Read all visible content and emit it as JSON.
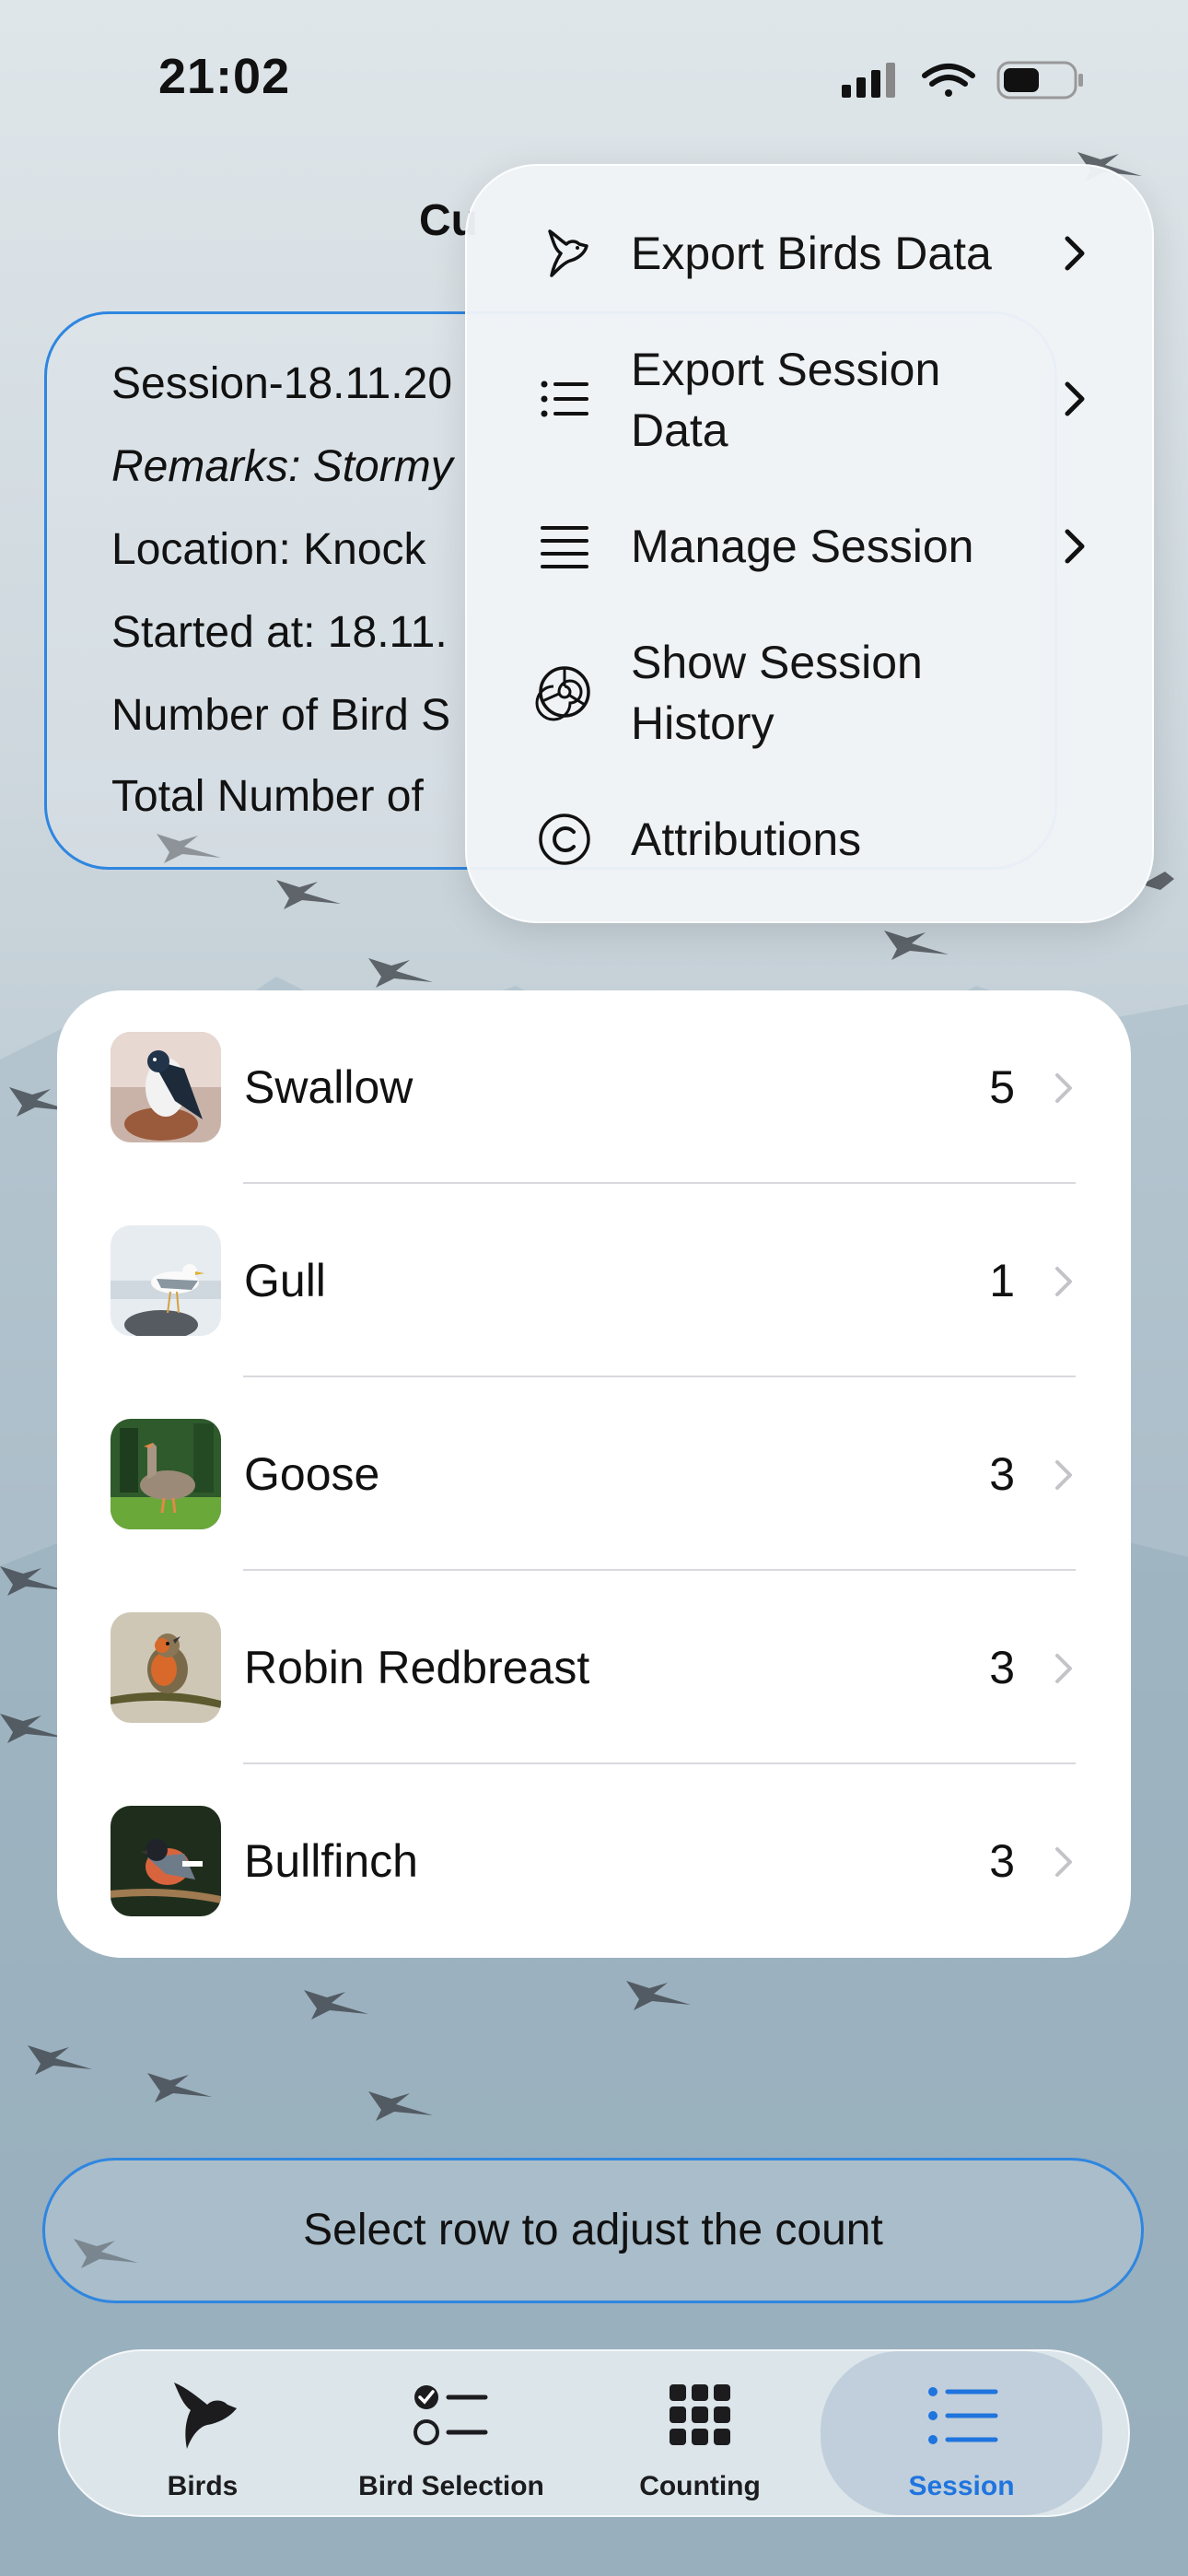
{
  "status_bar": {
    "time": "21:02"
  },
  "screen": {
    "title_fragment": "Cu"
  },
  "session_card": {
    "lines": [
      "Session-18.11.20",
      "Remarks: Stormy",
      "Location: Knock",
      "Started at: 18.11.",
      "Number of Bird S",
      "Total Number of"
    ]
  },
  "menu": {
    "items": [
      {
        "label": "Export Birds Data",
        "icon": "bird-icon",
        "has_submenu": true
      },
      {
        "label": "Export Session Data",
        "icon": "list-icon",
        "has_submenu": true
      },
      {
        "label": "Manage Session",
        "icon": "lines-icon",
        "has_submenu": true
      },
      {
        "label": "Show Session History",
        "icon": "shell-icon",
        "has_submenu": false
      },
      {
        "label": "Attributions",
        "icon": "copyright-icon",
        "has_submenu": false
      }
    ]
  },
  "birds": [
    {
      "name": "Swallow",
      "count": "5"
    },
    {
      "name": "Gull",
      "count": "1"
    },
    {
      "name": "Goose",
      "count": "3"
    },
    {
      "name": "Robin Redbreast",
      "count": "3"
    },
    {
      "name": "Bullfinch",
      "count": "3"
    }
  ],
  "hint": {
    "text": "Select row to adjust the count"
  },
  "tabbar": {
    "tabs": [
      {
        "label": "Birds",
        "icon": "bird-icon"
      },
      {
        "label": "Bird Selection",
        "icon": "checklist-icon"
      },
      {
        "label": "Counting",
        "icon": "grid-icon"
      },
      {
        "label": "Session",
        "icon": "list-icon"
      }
    ],
    "active": "Session"
  },
  "colors": {
    "accent": "#1f74de",
    "outline": "#2f86e0"
  }
}
